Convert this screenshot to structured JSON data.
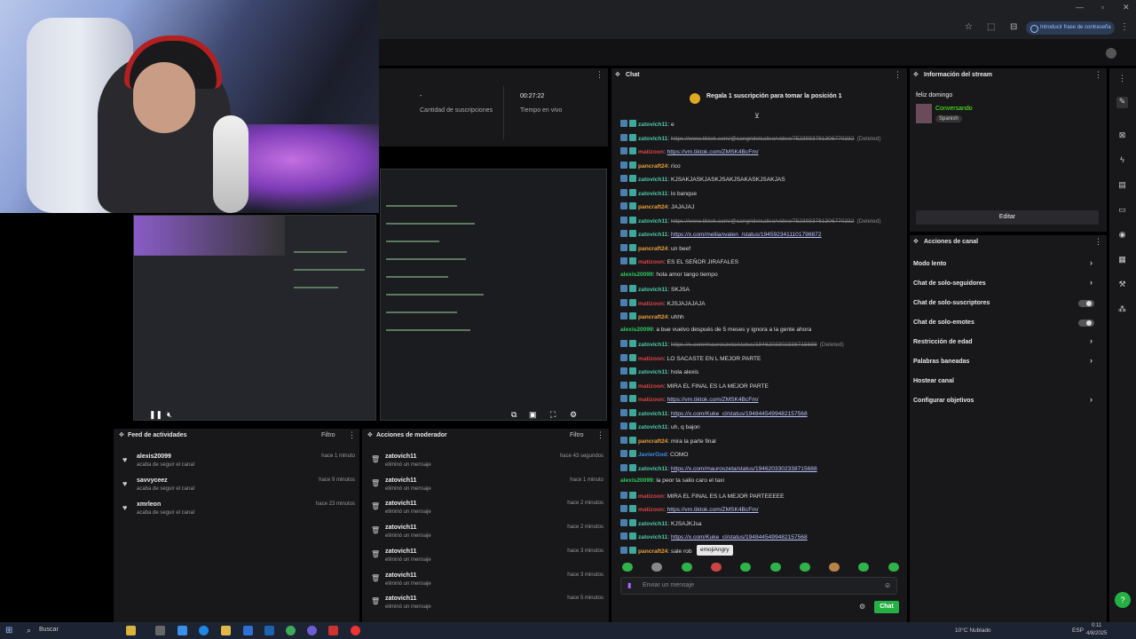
{
  "browser": {
    "password_hint": "Introducir frase de contraseña"
  },
  "stats": {
    "subs_value": "-",
    "subs_label": "Cantidad de suscripciones",
    "live_value": "00:27:22",
    "live_label": "Tiempo en vivo"
  },
  "feed": {
    "title": "Feed de actividades",
    "filter": "Filtro",
    "items": [
      {
        "name": "alexis20099",
        "sub": "acaba de seguir el canal",
        "time": "hace 1 minuto"
      },
      {
        "name": "savvyceez",
        "sub": "acaba de seguir el canal",
        "time": "hace 9 minutos"
      },
      {
        "name": "xmrleon",
        "sub": "acaba de seguir el canal",
        "time": "hace 23 minutos"
      }
    ]
  },
  "mod": {
    "title": "Acciones de moderador",
    "filter": "Filtro",
    "items": [
      {
        "name": "zatovich11",
        "sub": "eliminó un mensaje",
        "time": "hace 43 segundos"
      },
      {
        "name": "zatovich11",
        "sub": "eliminó un mensaje",
        "time": "hace 1 minuto"
      },
      {
        "name": "zatovich11",
        "sub": "eliminó un mensaje",
        "time": "hace 2 minutos"
      },
      {
        "name": "zatovich11",
        "sub": "eliminó un mensaje",
        "time": "hace 2 minutos"
      },
      {
        "name": "zatovich11",
        "sub": "eliminó un mensaje",
        "time": "hace 3 minutos"
      },
      {
        "name": "zatovich11",
        "sub": "eliminó un mensaje",
        "time": "hace 3 minutos"
      },
      {
        "name": "zatovich11",
        "sub": "eliminó un mensaje",
        "time": "hace 5 minutos"
      }
    ]
  },
  "chat": {
    "title": "Chat",
    "gift": "Regala 1 suscripción para tomar la posición 1",
    "tooltip": "emojiAngry",
    "placeholder": "Enviar un mensaje",
    "send": "Chat",
    "messages": [
      {
        "u": "zatovich11",
        "c": "z",
        "t": "e",
        "b": true
      },
      {
        "u": "zatovich11",
        "c": "z",
        "t": "https://www.tiktok.com/@cangridelcaliso/video/7523933781306770232",
        "b": true,
        "link": true,
        "del": true
      },
      {
        "u": "matizoon",
        "c": "m",
        "t": "https://vm.tiktok.com/ZMSK4BcFm/",
        "b": true,
        "link": true
      },
      {
        "u": "pancraft24",
        "c": "p",
        "t": "rico",
        "b": true
      },
      {
        "u": "zatovich11",
        "c": "z",
        "t": "KJSAKJASKJASKJSAKJSAKASKJSAKJAS",
        "b": true
      },
      {
        "u": "zatovich11",
        "c": "z",
        "t": "lo banque",
        "b": true
      },
      {
        "u": "pancraft24",
        "c": "p",
        "t": "JAJAJAJ",
        "b": true
      },
      {
        "u": "zatovich11",
        "c": "z",
        "t": "https://www.tiktok.com/@cangridelcaliso/video/7523933781306770232",
        "b": true,
        "link": true,
        "del": true
      },
      {
        "u": "zatovich11",
        "c": "z",
        "t": "https://x.com/meliianvalen_/status/1945923411101798872",
        "b": true,
        "link": true
      },
      {
        "u": "pancraft24",
        "c": "p",
        "t": "un beef",
        "b": true
      },
      {
        "u": "matizoon",
        "c": "m",
        "t": "ES EL SEÑOR JIRAFALES",
        "b": true
      },
      {
        "u": "alexis20099",
        "c": "a",
        "t": "hola amor tango tiempo",
        "b": false
      },
      {
        "u": "zatovich11",
        "c": "z",
        "t": "SKJSA",
        "b": true
      },
      {
        "u": "matizoon",
        "c": "m",
        "t": "KJSJAJAJAJA",
        "b": true
      },
      {
        "u": "pancraft24",
        "c": "p",
        "t": "uhhh",
        "b": true
      },
      {
        "u": "alexis20099",
        "c": "a",
        "t": "a bue vuelvo después de 5 meses y ignora a la gente ahora",
        "b": false
      },
      {
        "u": "zatovich11",
        "c": "z",
        "t": "https://x.com/mauroszeta/status/1946203302338715688",
        "b": true,
        "link": true,
        "del": true
      },
      {
        "u": "matizoon",
        "c": "m",
        "t": "LO SACASTE EN L MEJOR PARTE",
        "b": true
      },
      {
        "u": "zatovich11",
        "c": "z",
        "t": "hola alexis",
        "b": true
      },
      {
        "u": "matizoon",
        "c": "m",
        "t": "MIRA EL FINAL ES LA MEJOR PARTE",
        "b": true
      },
      {
        "u": "matizoon",
        "c": "m",
        "t": "https://vm.tiktok.com/ZMSK4BcFm/",
        "b": true,
        "link": true
      },
      {
        "u": "zatovich11",
        "c": "z",
        "t": "https://x.com/Kuke_cl/status/1948445499482157568",
        "b": true,
        "link": true
      },
      {
        "u": "zatovich11",
        "c": "z",
        "t": "uh, q bajon",
        "b": true
      },
      {
        "u": "pancraft24",
        "c": "p",
        "t": "mira la parte final",
        "b": true
      },
      {
        "u": "JavierGod",
        "c": "j",
        "t": "COMO",
        "b": true
      },
      {
        "u": "zatovich11",
        "c": "z",
        "t": "https://x.com/mauroszeta/status/1946203302338715688",
        "b": true,
        "link": true
      },
      {
        "u": "alexis20099",
        "c": "a",
        "t": "la peor ta salio caro el taxi",
        "b": false
      },
      {
        "u": "matizoon",
        "c": "m",
        "t": "MIRA EL FINAL ES LA MEJOR PARTEEEEE",
        "b": true
      },
      {
        "u": "matizoon",
        "c": "m",
        "t": "https://vm.tiktok.com/ZMSK4BcFm/",
        "b": true,
        "link": true
      },
      {
        "u": "zatovich11",
        "c": "z",
        "t": "KJSAJKJsa",
        "b": true
      },
      {
        "u": "zatovich11",
        "c": "z",
        "t": "https://x.com/Kuke_cl/status/1948445499482157568",
        "b": true,
        "link": true
      },
      {
        "u": "pancraft24",
        "c": "p",
        "t": "sale rob",
        "b": true
      }
    ],
    "deleted_tag": "(Deleted)"
  },
  "info": {
    "title": "Información del stream",
    "stream_title": "feliz domingo",
    "category": "Conversando",
    "language": "Spanish",
    "edit": "Editar"
  },
  "actions": {
    "title": "Acciones de canal",
    "items": [
      {
        "label": "Modo lento",
        "type": "chevron"
      },
      {
        "label": "Chat de solo-seguidores",
        "type": "chevron"
      },
      {
        "label": "Chat de solo-suscriptores",
        "type": "toggle"
      },
      {
        "label": "Chat de solo-emotes",
        "type": "toggle"
      },
      {
        "label": "Restricción de edad",
        "type": "chevron"
      },
      {
        "label": "Palabras baneadas",
        "type": "chevron"
      },
      {
        "label": "Hostear canal",
        "type": "none"
      },
      {
        "label": "Configurar objetivos",
        "type": "chevron"
      }
    ]
  },
  "taskbar": {
    "search": "Buscar",
    "weather": "10°C  Nublado",
    "lang": "ESP",
    "time": "0:11",
    "date": "4/8/2025"
  },
  "colors": {
    "accent": "#25b044",
    "bg": "#18181b"
  }
}
